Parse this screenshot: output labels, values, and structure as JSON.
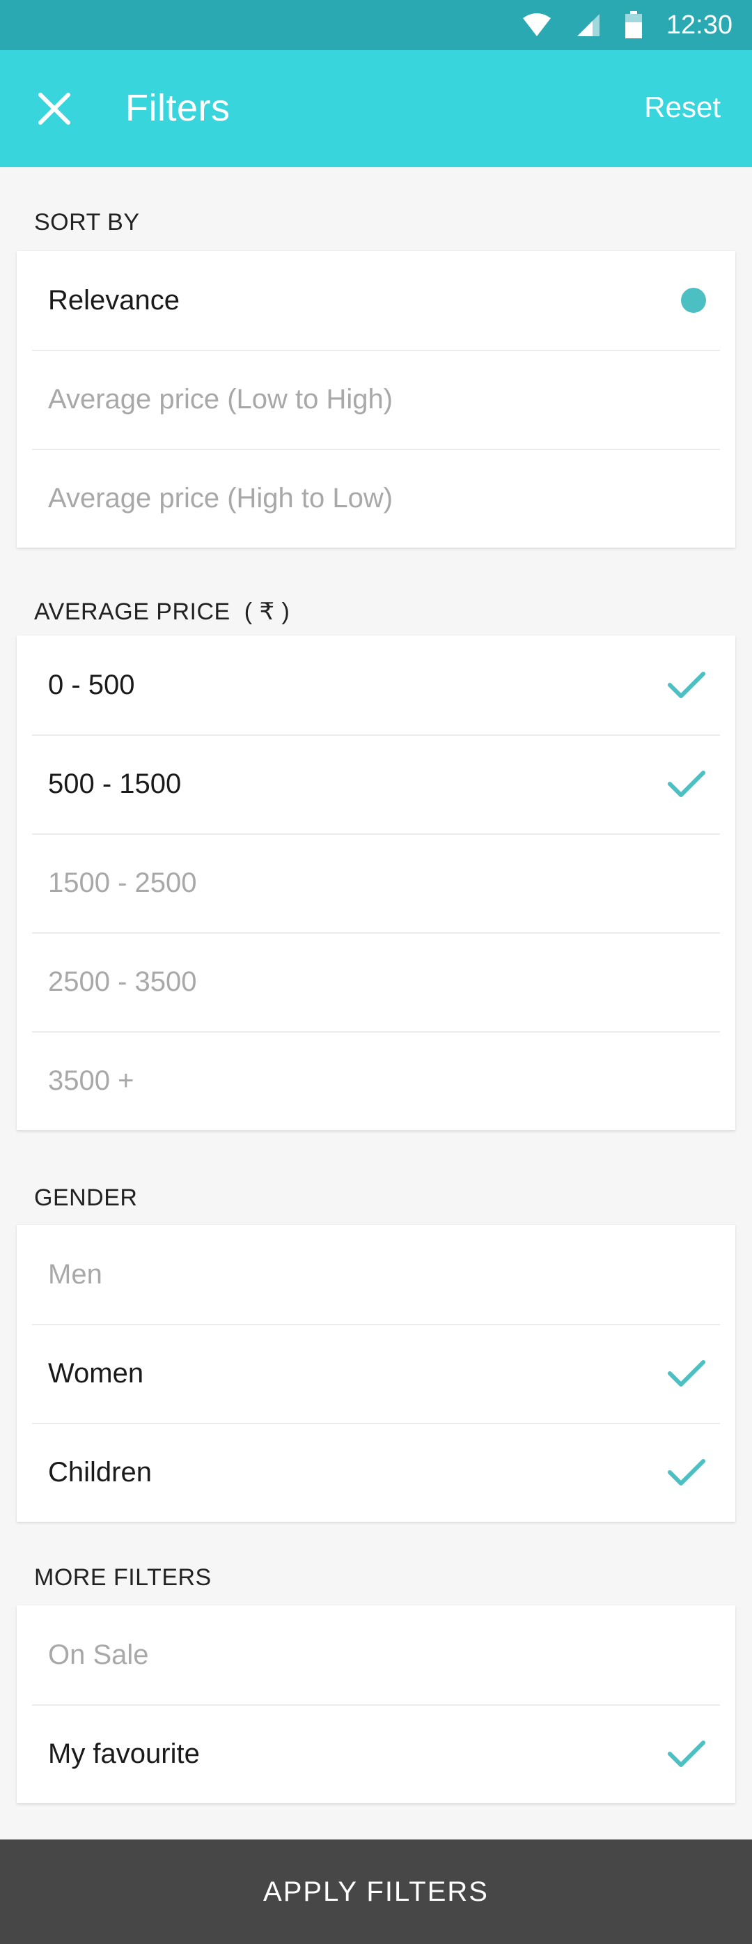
{
  "status_bar": {
    "time": "12:30",
    "icons": [
      "wifi-icon",
      "signal-icon",
      "battery-icon"
    ]
  },
  "header": {
    "title": "Filters",
    "reset_label": "Reset",
    "close_icon": "close-icon"
  },
  "colors": {
    "status_bar": "#2aa9b3",
    "app_bar": "#39d5dc",
    "accent": "#4cbfc3",
    "apply_bar": "#474747"
  },
  "sort_by": {
    "title": "SORT BY",
    "options": [
      {
        "label": "Relevance",
        "selected": true
      },
      {
        "label": "Average price (Low to  High)",
        "selected": false
      },
      {
        "label": "Average price (High to Low)",
        "selected": false
      }
    ]
  },
  "average_price": {
    "title": "AVERAGE PRICE",
    "currency": "( ₹ )",
    "options": [
      {
        "label": "0 - 500",
        "checked": true
      },
      {
        "label": "500 - 1500",
        "checked": true
      },
      {
        "label": "1500 - 2500",
        "checked": false
      },
      {
        "label": "2500 - 3500",
        "checked": false
      },
      {
        "label": "3500 +",
        "checked": false
      }
    ]
  },
  "gender": {
    "title": "GENDER",
    "options": [
      {
        "label": "Men",
        "checked": false
      },
      {
        "label": "Women",
        "checked": true
      },
      {
        "label": "Children",
        "checked": true
      }
    ]
  },
  "more_filters": {
    "title": "MORE FILTERS",
    "options": [
      {
        "label": "On Sale",
        "checked": false
      },
      {
        "label": "My favourite",
        "checked": true
      }
    ]
  },
  "apply_label": "APPLY FILTERS"
}
